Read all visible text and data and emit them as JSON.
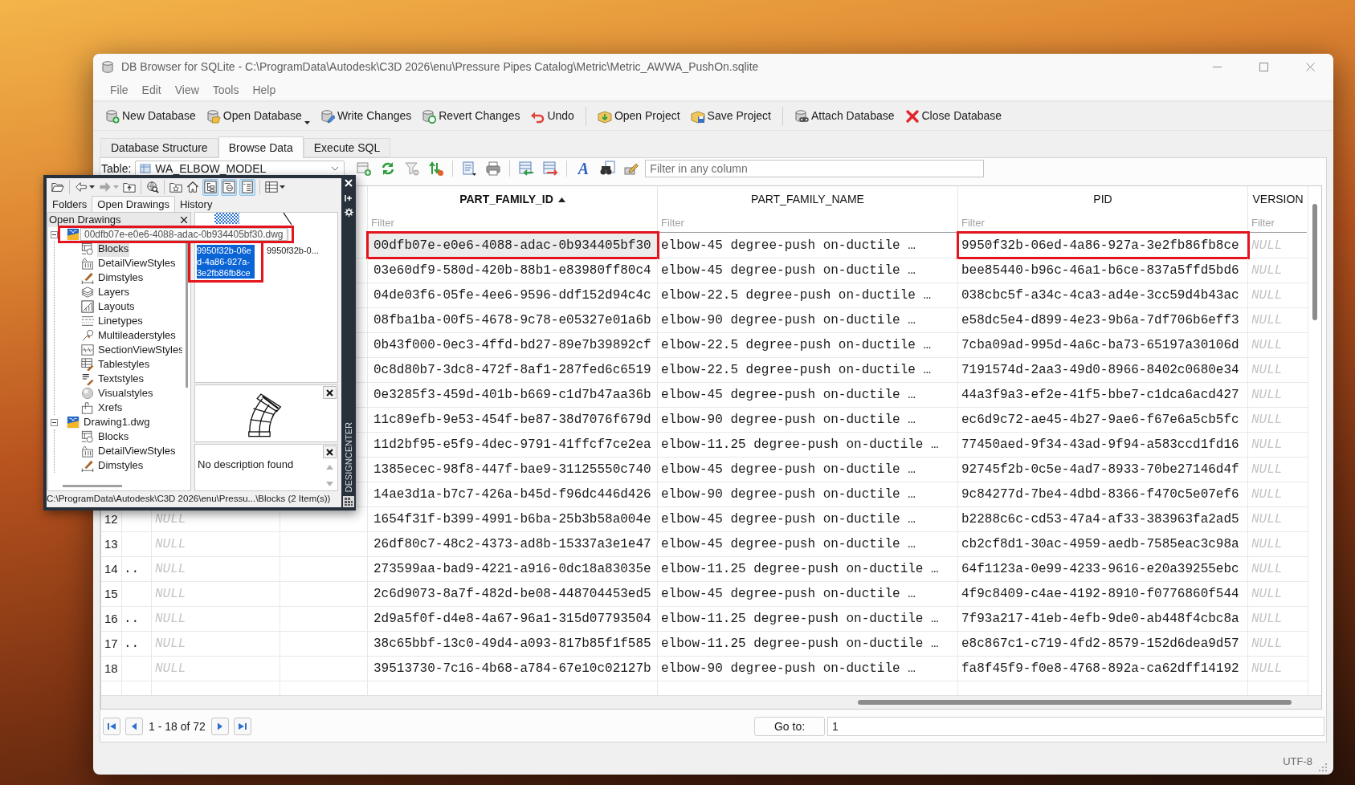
{
  "window": {
    "title": "DB Browser for SQLite - C:\\ProgramData\\Autodesk\\C3D 2026\\enu\\Pressure Pipes Catalog\\Metric\\Metric_AWWA_PushOn.sqlite"
  },
  "menu": [
    "File",
    "Edit",
    "View",
    "Tools",
    "Help"
  ],
  "toolbar": [
    {
      "kind": "new_db",
      "label": "New Database",
      "dropdown": false
    },
    {
      "kind": "open_db",
      "label": "Open Database",
      "dropdown": true
    },
    {
      "kind": "write",
      "label": "Write Changes",
      "dropdown": false
    },
    {
      "kind": "revert",
      "label": "Revert Changes",
      "dropdown": false
    },
    {
      "kind": "undo",
      "label": "Undo",
      "dropdown": false
    },
    {
      "kind": "separator"
    },
    {
      "kind": "open_project",
      "label": "Open Project",
      "dropdown": false
    },
    {
      "kind": "save_project",
      "label": "Save Project",
      "dropdown": false
    },
    {
      "kind": "separator"
    },
    {
      "kind": "attach",
      "label": "Attach Database",
      "dropdown": false
    },
    {
      "kind": "close_db",
      "label": "Close Database",
      "dropdown": false
    }
  ],
  "tabs": [
    {
      "label": "Database Structure",
      "selected": false
    },
    {
      "label": "Browse Data",
      "selected": true
    },
    {
      "label": "Execute SQL",
      "selected": false
    }
  ],
  "browse": {
    "table_label": "Table:",
    "table": "WA_ELBOW_MODEL",
    "tools": [
      {
        "kind": "add_record"
      },
      {
        "kind": "refresh"
      },
      {
        "kind": "clear_filters"
      },
      {
        "kind": "clear_sort"
      },
      {
        "kind": "separator"
      },
      {
        "kind": "save_table"
      },
      {
        "kind": "print"
      },
      {
        "kind": "separator"
      },
      {
        "kind": "insert_record"
      },
      {
        "kind": "delete_record"
      },
      {
        "kind": "separator"
      },
      {
        "kind": "font",
        "glyph": "A"
      },
      {
        "kind": "find"
      },
      {
        "kind": "edit"
      }
    ],
    "filter_placeholder": "Filter in any column"
  },
  "table": {
    "columns": [
      {
        "null_values": true
      },
      {
        "title": "PART_FAMILY_ID",
        "sorted": true,
        "filter_placeholder": "Filter",
        "null_values": false
      },
      {
        "title": "PART_FAMILY_NAME",
        "sorted": false,
        "filter_placeholder": "Filter",
        "null_values": false
      },
      {
        "title": "PID",
        "sorted": false,
        "filter_placeholder": "Filter",
        "null_values": false
      },
      {
        "title": "VERSION",
        "sorted": false,
        "filter_placeholder": "Filter",
        "null_values": true
      }
    ],
    "rows": [
      {
        "selected": true,
        "id_boxed": true,
        "pid_boxed": true,
        "part_family_id": "00dfb07e-e0e6-4088-adac-0b934405bf30",
        "part_family_name": "elbow-45 degree-push on-ductile …",
        "pid": "9950f32b-06ed-4a86-927a-3e2fb86fb8ce",
        "version": "NULL"
      },
      {
        "selected": false,
        "id_boxed": false,
        "pid_boxed": false,
        "part_family_id": "03e60df9-580d-420b-88b1-e83980ff80c4",
        "part_family_name": "elbow-45 degree-push on-ductile …",
        "pid": "bee85440-b96c-46a1-b6ce-837a5ffd5bd6",
        "version": "NULL"
      },
      {
        "selected": false,
        "id_boxed": false,
        "pid_boxed": false,
        "part_family_id": "04de03f6-05fe-4ee6-9596-ddf152d94c4c",
        "part_family_name": "elbow-22.5 degree-push on-ductile …",
        "pid": "038cbc5f-a34c-4ca3-ad4e-3cc59d4b43ac",
        "version": "NULL"
      },
      {
        "selected": false,
        "id_boxed": false,
        "pid_boxed": false,
        "part_family_id": "08fba1ba-00f5-4678-9c78-e05327e01a6b",
        "part_family_name": "elbow-90 degree-push on-ductile …",
        "pid": "e58dc5e4-d899-4e23-9b6a-7df706b6eff3",
        "version": "NULL"
      },
      {
        "selected": false,
        "id_boxed": false,
        "pid_boxed": false,
        "part_family_id": "0b43f000-0ec3-4ffd-bd27-89e7b39892cf",
        "part_family_name": "elbow-22.5 degree-push on-ductile …",
        "pid": "7cba09ad-995d-4a6c-ba73-65197a30106d",
        "version": "NULL"
      },
      {
        "selected": false,
        "id_boxed": false,
        "pid_boxed": false,
        "part_family_id": "0c8d80b7-3dc8-472f-8af1-287fed6c6519",
        "part_family_name": "elbow-22.5 degree-push on-ductile …",
        "pid": "7191574d-2aa3-49d0-8966-8402c0680e34",
        "version": "NULL"
      },
      {
        "selected": false,
        "id_boxed": false,
        "pid_boxed": false,
        "part_family_id": "0e3285f3-459d-401b-b669-c1d7b47aa36b",
        "part_family_name": "elbow-45 degree-push on-ductile …",
        "pid": "44a3f9a3-ef2e-41f5-bbe7-c1dca6acd427",
        "version": "NULL"
      },
      {
        "selected": false,
        "id_boxed": false,
        "pid_boxed": false,
        "part_family_id": "11c89efb-9e53-454f-be87-38d7076f679d",
        "part_family_name": "elbow-90 degree-push on-ductile …",
        "pid": "ec6d9c72-ae45-4b27-9ae6-f67e6a5cb5fc",
        "version": "NULL"
      },
      {
        "selected": false,
        "id_boxed": false,
        "pid_boxed": false,
        "part_family_id": "11d2bf95-e5f9-4dec-9791-41ffcf7ce2ea",
        "part_family_name": "elbow-11.25 degree-push on-ductile …",
        "pid": "77450aed-9f34-43ad-9f94-a583ccd1fd16",
        "version": "NULL"
      },
      {
        "selected": false,
        "id_boxed": false,
        "pid_boxed": false,
        "part_family_id": "1385ecec-98f8-447f-bae9-31125550c740",
        "part_family_name": "elbow-45 degree-push on-ductile …",
        "pid": "92745f2b-0c5e-4ad7-8933-70be27146d4f",
        "version": "NULL"
      },
      {
        "selected": false,
        "id_boxed": false,
        "pid_boxed": false,
        "part_family_id": "14ae3d1a-b7c7-426a-b45d-f96dc446d426",
        "part_family_name": "elbow-90 degree-push on-ductile …",
        "pid": "9c84277d-7be4-4dbd-8366-f470c5e07ef6",
        "version": "NULL"
      },
      {
        "selected": false,
        "id_boxed": false,
        "pid_boxed": false,
        "row_number": "12",
        "column_2": "NULL",
        "part_family_id": "1654f31f-b399-4991-b6ba-25b3b58a004e",
        "part_family_name": "elbow-45 degree-push on-ductile …",
        "pid": "b2288c6c-cd53-47a4-af33-383963fa2ad5",
        "version": "NULL"
      },
      {
        "selected": false,
        "id_boxed": false,
        "pid_boxed": false,
        "row_number": "13",
        "column_2": "NULL",
        "part_family_id": "26df80c7-48c2-4373-ad8b-15337a3e1e47",
        "part_family_name": "elbow-45 degree-push on-ductile …",
        "pid": "cb2cf8d1-30ac-4959-aedb-7585eac3c98a",
        "version": "NULL"
      },
      {
        "selected": false,
        "id_boxed": false,
        "pid_boxed": false,
        "row_number": "14",
        "column_1": "..",
        "column_2": "NULL",
        "part_family_id": "273599aa-bad9-4221-a916-0dc18a83035e",
        "part_family_name": "elbow-11.25 degree-push on-ductile …",
        "pid": "64f1123a-0e99-4233-9616-e20a39255ebc",
        "version": "NULL"
      },
      {
        "selected": false,
        "id_boxed": false,
        "pid_boxed": false,
        "row_number": "15",
        "column_2": "NULL",
        "part_family_id": "2c6d9073-8a7f-482d-be08-448704453ed5",
        "part_family_name": "elbow-45 degree-push on-ductile …",
        "pid": "4f9c8409-c4ae-4192-8910-f0776860f544",
        "version": "NULL"
      },
      {
        "selected": false,
        "id_boxed": false,
        "pid_boxed": false,
        "row_number": "16",
        "column_1": "..",
        "column_2": "NULL",
        "part_family_id": "2d9a5f0f-d4e8-4a67-96a1-315d07793504",
        "part_family_name": "elbow-11.25 degree-push on-ductile …",
        "pid": "7f93a217-41eb-4efb-9de0-ab448f4cbc8a",
        "version": "NULL"
      },
      {
        "selected": false,
        "id_boxed": false,
        "pid_boxed": false,
        "row_number": "17",
        "column_1": "..",
        "column_2": "NULL",
        "part_family_id": "38c65bbf-13c0-49d4-a093-817b85f1f585",
        "part_family_name": "elbow-11.25 degree-push on-ductile …",
        "pid": "e8c867c1-c719-4fd2-8579-152d6dea9d57",
        "version": "NULL"
      },
      {
        "selected": false,
        "id_boxed": false,
        "pid_boxed": false,
        "row_number": "18",
        "column_2": "NULL",
        "part_family_id": "39513730-7c16-4b68-a784-67e10c02127b",
        "part_family_name": "elbow-90 degree-push on-ductile …",
        "pid": "fa8f45f9-f0e8-4768-892a-ca62dff14192",
        "version": "NULL"
      }
    ]
  },
  "pagination": {
    "items": [
      {
        "kind": "first"
      },
      {
        "kind": "previous"
      },
      {
        "kind": "range",
        "label": "1 - 18 of 72"
      },
      {
        "kind": "next"
      },
      {
        "kind": "last"
      }
    ],
    "goto_label": "Go to:",
    "goto_value": "1"
  },
  "status_bar": {
    "encoding": "UTF-8"
  },
  "design_center": {
    "title": "DESIGNCENTER",
    "tools": [
      {
        "kind": "load",
        "pressed": false,
        "disabled": false,
        "dropdown": false
      },
      {
        "kind": "separator"
      },
      {
        "kind": "back",
        "pressed": false,
        "disabled": false,
        "dropdown": true
      },
      {
        "kind": "forward",
        "pressed": false,
        "disabled": true,
        "dropdown": true
      },
      {
        "kind": "up",
        "pressed": false,
        "disabled": false,
        "dropdown": false
      },
      {
        "kind": "separator"
      },
      {
        "kind": "search",
        "pressed": false,
        "disabled": false,
        "dropdown": false
      },
      {
        "kind": "separator"
      },
      {
        "kind": "favorites",
        "pressed": false,
        "disabled": false,
        "dropdown": false
      },
      {
        "kind": "home",
        "pressed": false,
        "disabled": false,
        "dropdown": false
      },
      {
        "kind": "tree",
        "pressed": true,
        "disabled": false,
        "dropdown": false
      },
      {
        "kind": "preview",
        "pressed": true,
        "disabled": false,
        "dropdown": false
      },
      {
        "kind": "description",
        "pressed": true,
        "disabled": false,
        "dropdown": false
      },
      {
        "kind": "separator"
      },
      {
        "kind": "views",
        "pressed": false,
        "disabled": false,
        "dropdown": true
      }
    ],
    "tabs": [
      {
        "label": "Folders",
        "selected": false
      },
      {
        "label": "Open Drawings",
        "selected": true
      },
      {
        "label": "History",
        "selected": false
      }
    ],
    "tree_header": "Open Drawings",
    "tree": [
      {
        "kind": "drawing",
        "expanded": true,
        "children": [
          {
            "kind": "blocks",
            "label": "Blocks",
            "selected": true
          },
          {
            "kind": "detail_view_styles",
            "label": "DetailViewStyles",
            "selected": false
          },
          {
            "kind": "dimstyles",
            "label": "Dimstyles",
            "selected": false
          },
          {
            "kind": "layers",
            "label": "Layers",
            "selected": false
          },
          {
            "kind": "layouts",
            "label": "Layouts",
            "selected": false
          },
          {
            "kind": "linetypes",
            "label": "Linetypes",
            "selected": false
          },
          {
            "kind": "multileaderstyles",
            "label": "Multileaderstyles",
            "selected": false
          },
          {
            "kind": "section_view_styles",
            "label": "SectionViewStyles",
            "selected": false
          },
          {
            "kind": "tablestyles",
            "label": "Tablestyles",
            "selected": false
          },
          {
            "kind": "textstyles",
            "label": "Textstyles",
            "selected": false
          },
          {
            "kind": "visualstyles",
            "label": "Visualstyles",
            "selected": false
          },
          {
            "kind": "xrefs",
            "label": "Xrefs",
            "selected": false
          }
        ]
      },
      {
        "kind": "drawing",
        "label": "Drawing1.dwg",
        "selected": false,
        "expanded": true,
        "children": [
          {
            "kind": "blocks",
            "label": "Blocks",
            "selected": false
          },
          {
            "kind": "detail_view_styles",
            "label": "DetailViewStyles",
            "selected": false
          },
          {
            "kind": "dimstyles",
            "label": "Dimstyles",
            "selected": false
          }
        ]
      }
    ],
    "tooltip": {
      "text": "00dfb07e-e0e6-4088-adac-0b934405bf30.dwg",
      "boxed": true
    },
    "previews": [
      {
        "label": "9950f32b-06ed-4a86-927a-3e2fb86fb8ce",
        "selected": true,
        "boxed": true
      },
      {
        "label": "9950f32b-0...",
        "selected": false,
        "boxed": false
      }
    ],
    "description": "No description found",
    "path": "C:\\ProgramData\\Autodesk\\C3D 2026\\enu\\Pressu...\\Blocks (2 Item(s))"
  }
}
